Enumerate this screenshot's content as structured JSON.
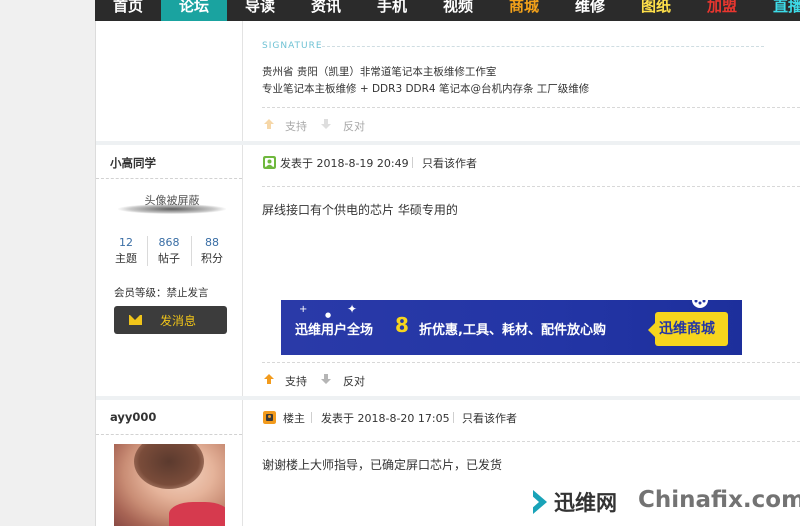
{
  "nav": {
    "items": [
      {
        "label": "首页",
        "color": "#ffffff"
      },
      {
        "label": "论坛",
        "color": "#ffffff",
        "active": true
      },
      {
        "label": "导读",
        "color": "#ffffff"
      },
      {
        "label": "资讯",
        "color": "#ffffff"
      },
      {
        "label": "手机",
        "color": "#ffffff"
      },
      {
        "label": "视频",
        "color": "#ffffff"
      },
      {
        "label": "商城",
        "color": "#f4a21a"
      },
      {
        "label": "维修",
        "color": "#ffffff"
      },
      {
        "label": "图纸",
        "color": "#ffe04a"
      },
      {
        "label": "加盟",
        "color": "#e8362f"
      },
      {
        "label": "直播",
        "color": "#3ddbe8"
      }
    ]
  },
  "signature": {
    "label": "SIGNATURE",
    "line1": "贵州省 贵阳（凯里）非常道笔记本主板维修工作室",
    "line2": "专业笔记本主板维修 +    DDR3 DDR4 笔记本@台机内存条 工厂级维修"
  },
  "votes": {
    "support": "支持",
    "oppose": "反对"
  },
  "post1": {
    "username": "小高同学",
    "avatar_hidden": "头像被屏蔽",
    "stats": [
      {
        "num": "12",
        "label": "主题"
      },
      {
        "num": "868",
        "label": "帖子"
      },
      {
        "num": "88",
        "label": "积分"
      }
    ],
    "level": "会员等级：禁止发言",
    "message_button": "发消息",
    "posted": "发表于 2018-8-19 20:49",
    "author_only": "只看该作者",
    "content": "屏线接口有个供电的芯片   华硕专用的"
  },
  "ad": {
    "text_left": "迅维用户全场",
    "discount": "8",
    "text_right": "折优惠,工具、耗材、配件放心购",
    "tag": "迅维商城"
  },
  "post2": {
    "username": "ayy000",
    "owner": "楼主",
    "posted": "发表于 2018-8-20 17:05",
    "author_only": "只看该作者",
    "content": "谢谢楼上大师指导，已确定屏口芯片，已发货"
  },
  "watermark": {
    "cn": "迅维网",
    "en": "Chinafix.com"
  },
  "colors": {
    "accent": "#1aa3a0",
    "nav_bg": "#2b2b2b",
    "button_yellow": "#f0c419",
    "ad_blue": "#2335a5"
  }
}
